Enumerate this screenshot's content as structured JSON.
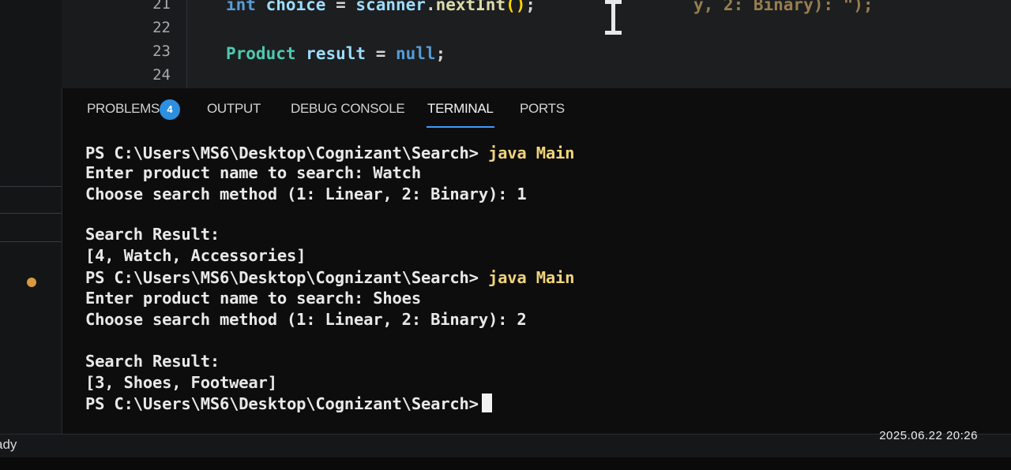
{
  "editor": {
    "line_numbers": [
      "21",
      "22",
      "23",
      "24"
    ],
    "code_line_21": {
      "type": "int",
      "var": "choice",
      "eq": "=",
      "obj": "scanner",
      "dot": ".",
      "fn": "nextInt",
      "paren": "()",
      "semi": ";"
    },
    "code_line_23": {
      "type": "Product",
      "var": "result",
      "eq": "=",
      "val": "null",
      "semi": ";"
    },
    "faded_code": "y, 2: Binary): \");"
  },
  "panel": {
    "tabs": [
      {
        "label": "PROBLEMS"
      },
      {
        "label": "OUTPUT"
      },
      {
        "label": "DEBUG CONSOLE"
      },
      {
        "label": "TERMINAL"
      },
      {
        "label": "PORTS"
      }
    ],
    "problems_count": "4",
    "active_tab": "TERMINAL"
  },
  "terminal": {
    "prompt": "PS C:\\Users\\MS6\\Desktop\\Cognizant\\Search>",
    "command": "java Main",
    "lines": [
      "Enter product name to search: Watch",
      "Choose search method (1: Linear, 2: Binary): 1",
      "Search Result:",
      "[4, Watch, Accessories]",
      "Enter product name to search: Shoes",
      "Choose search method (1: Linear, 2: Binary): 2",
      "Search Result:",
      "[3, Shoes, Footwear]"
    ]
  },
  "status_bar": {
    "text": "ady"
  },
  "timestamp": "2025.06.22 20:26",
  "colors": {
    "accent": "#3e9bff",
    "badge": "#2c8fe0",
    "command": "#f0d479"
  }
}
